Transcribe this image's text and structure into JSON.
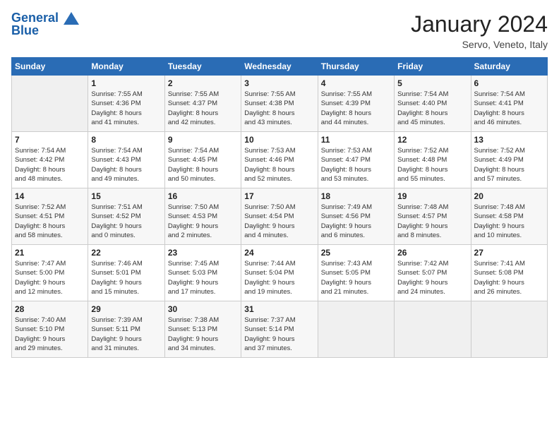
{
  "header": {
    "logo_line1": "General",
    "logo_line2": "Blue",
    "title": "January 2024",
    "subtitle": "Servo, Veneto, Italy"
  },
  "weekdays": [
    "Sunday",
    "Monday",
    "Tuesday",
    "Wednesday",
    "Thursday",
    "Friday",
    "Saturday"
  ],
  "weeks": [
    [
      {
        "day": "",
        "detail": ""
      },
      {
        "day": "1",
        "detail": "Sunrise: 7:55 AM\nSunset: 4:36 PM\nDaylight: 8 hours\nand 41 minutes."
      },
      {
        "day": "2",
        "detail": "Sunrise: 7:55 AM\nSunset: 4:37 PM\nDaylight: 8 hours\nand 42 minutes."
      },
      {
        "day": "3",
        "detail": "Sunrise: 7:55 AM\nSunset: 4:38 PM\nDaylight: 8 hours\nand 43 minutes."
      },
      {
        "day": "4",
        "detail": "Sunrise: 7:55 AM\nSunset: 4:39 PM\nDaylight: 8 hours\nand 44 minutes."
      },
      {
        "day": "5",
        "detail": "Sunrise: 7:54 AM\nSunset: 4:40 PM\nDaylight: 8 hours\nand 45 minutes."
      },
      {
        "day": "6",
        "detail": "Sunrise: 7:54 AM\nSunset: 4:41 PM\nDaylight: 8 hours\nand 46 minutes."
      }
    ],
    [
      {
        "day": "7",
        "detail": "Sunrise: 7:54 AM\nSunset: 4:42 PM\nDaylight: 8 hours\nand 48 minutes."
      },
      {
        "day": "8",
        "detail": "Sunrise: 7:54 AM\nSunset: 4:43 PM\nDaylight: 8 hours\nand 49 minutes."
      },
      {
        "day": "9",
        "detail": "Sunrise: 7:54 AM\nSunset: 4:45 PM\nDaylight: 8 hours\nand 50 minutes."
      },
      {
        "day": "10",
        "detail": "Sunrise: 7:53 AM\nSunset: 4:46 PM\nDaylight: 8 hours\nand 52 minutes."
      },
      {
        "day": "11",
        "detail": "Sunrise: 7:53 AM\nSunset: 4:47 PM\nDaylight: 8 hours\nand 53 minutes."
      },
      {
        "day": "12",
        "detail": "Sunrise: 7:52 AM\nSunset: 4:48 PM\nDaylight: 8 hours\nand 55 minutes."
      },
      {
        "day": "13",
        "detail": "Sunrise: 7:52 AM\nSunset: 4:49 PM\nDaylight: 8 hours\nand 57 minutes."
      }
    ],
    [
      {
        "day": "14",
        "detail": "Sunrise: 7:52 AM\nSunset: 4:51 PM\nDaylight: 8 hours\nand 58 minutes."
      },
      {
        "day": "15",
        "detail": "Sunrise: 7:51 AM\nSunset: 4:52 PM\nDaylight: 9 hours\nand 0 minutes."
      },
      {
        "day": "16",
        "detail": "Sunrise: 7:50 AM\nSunset: 4:53 PM\nDaylight: 9 hours\nand 2 minutes."
      },
      {
        "day": "17",
        "detail": "Sunrise: 7:50 AM\nSunset: 4:54 PM\nDaylight: 9 hours\nand 4 minutes."
      },
      {
        "day": "18",
        "detail": "Sunrise: 7:49 AM\nSunset: 4:56 PM\nDaylight: 9 hours\nand 6 minutes."
      },
      {
        "day": "19",
        "detail": "Sunrise: 7:48 AM\nSunset: 4:57 PM\nDaylight: 9 hours\nand 8 minutes."
      },
      {
        "day": "20",
        "detail": "Sunrise: 7:48 AM\nSunset: 4:58 PM\nDaylight: 9 hours\nand 10 minutes."
      }
    ],
    [
      {
        "day": "21",
        "detail": "Sunrise: 7:47 AM\nSunset: 5:00 PM\nDaylight: 9 hours\nand 12 minutes."
      },
      {
        "day": "22",
        "detail": "Sunrise: 7:46 AM\nSunset: 5:01 PM\nDaylight: 9 hours\nand 15 minutes."
      },
      {
        "day": "23",
        "detail": "Sunrise: 7:45 AM\nSunset: 5:03 PM\nDaylight: 9 hours\nand 17 minutes."
      },
      {
        "day": "24",
        "detail": "Sunrise: 7:44 AM\nSunset: 5:04 PM\nDaylight: 9 hours\nand 19 minutes."
      },
      {
        "day": "25",
        "detail": "Sunrise: 7:43 AM\nSunset: 5:05 PM\nDaylight: 9 hours\nand 21 minutes."
      },
      {
        "day": "26",
        "detail": "Sunrise: 7:42 AM\nSunset: 5:07 PM\nDaylight: 9 hours\nand 24 minutes."
      },
      {
        "day": "27",
        "detail": "Sunrise: 7:41 AM\nSunset: 5:08 PM\nDaylight: 9 hours\nand 26 minutes."
      }
    ],
    [
      {
        "day": "28",
        "detail": "Sunrise: 7:40 AM\nSunset: 5:10 PM\nDaylight: 9 hours\nand 29 minutes."
      },
      {
        "day": "29",
        "detail": "Sunrise: 7:39 AM\nSunset: 5:11 PM\nDaylight: 9 hours\nand 31 minutes."
      },
      {
        "day": "30",
        "detail": "Sunrise: 7:38 AM\nSunset: 5:13 PM\nDaylight: 9 hours\nand 34 minutes."
      },
      {
        "day": "31",
        "detail": "Sunrise: 7:37 AM\nSunset: 5:14 PM\nDaylight: 9 hours\nand 37 minutes."
      },
      {
        "day": "",
        "detail": ""
      },
      {
        "day": "",
        "detail": ""
      },
      {
        "day": "",
        "detail": ""
      }
    ]
  ]
}
